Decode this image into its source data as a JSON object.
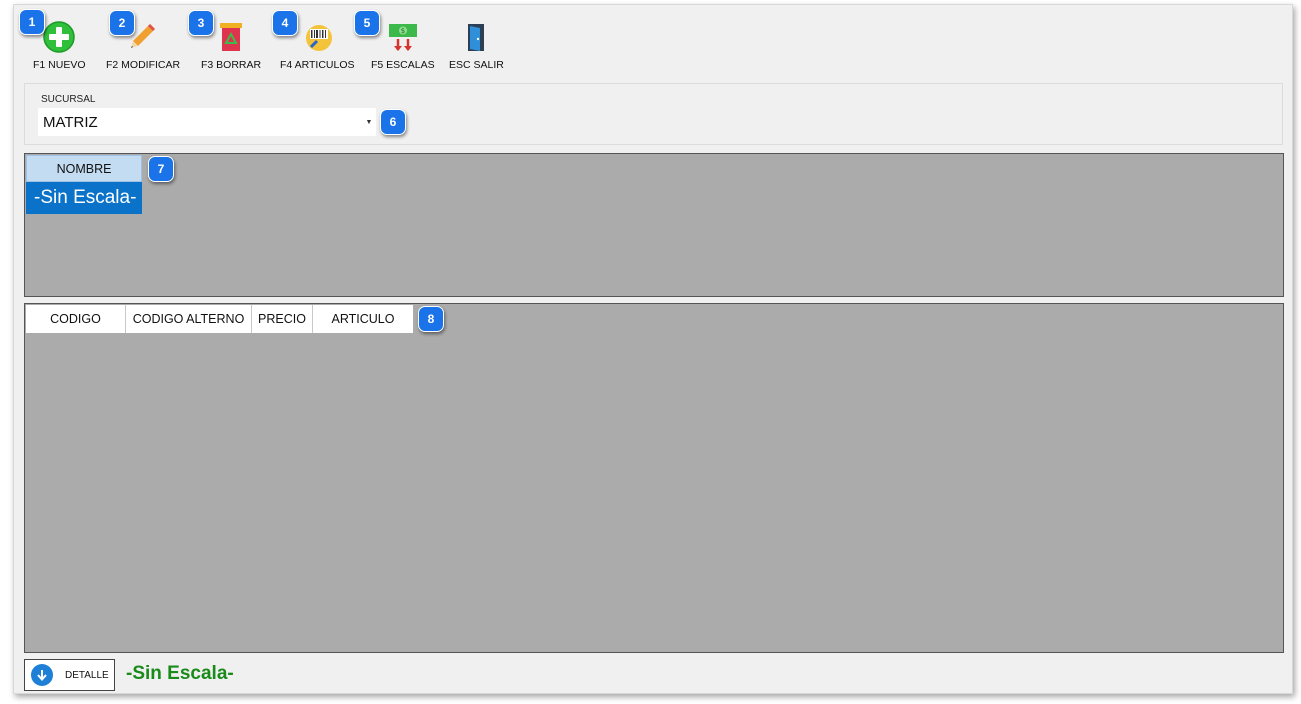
{
  "toolbar": {
    "items": [
      {
        "label": "F1 NUEVO",
        "icon": "add-icon",
        "badge": "1"
      },
      {
        "label": "F2 MODIFICAR",
        "icon": "pencil-icon",
        "badge": "2"
      },
      {
        "label": "F3 BORRAR",
        "icon": "trash-icon",
        "badge": "3"
      },
      {
        "label": "F4 ARTICULOS",
        "icon": "barcode-search-icon",
        "badge": "4"
      },
      {
        "label": "F5 ESCALAS",
        "icon": "money-scale-icon",
        "badge": "5"
      },
      {
        "label": "ESC SALIR",
        "icon": "exit-door-icon"
      }
    ]
  },
  "sucursal": {
    "label": "SUCURSAL",
    "value": "MATRIZ",
    "badge": "6"
  },
  "escalas_grid": {
    "header": "NOMBRE",
    "badge": "7",
    "rows": [
      "-Sin Escala-"
    ]
  },
  "articulos_grid": {
    "headers": [
      "CODIGO",
      "CODIGO ALTERNO",
      "PRECIO",
      "ARTICULO"
    ],
    "badge": "8"
  },
  "footer": {
    "detalle_label": "DETALLE",
    "status": "-Sin Escala-"
  },
  "colors": {
    "badge": "#1a73e8",
    "selected_row": "#0a73c9",
    "grid_bg": "#ababab",
    "status_text": "#1a8a1a"
  }
}
